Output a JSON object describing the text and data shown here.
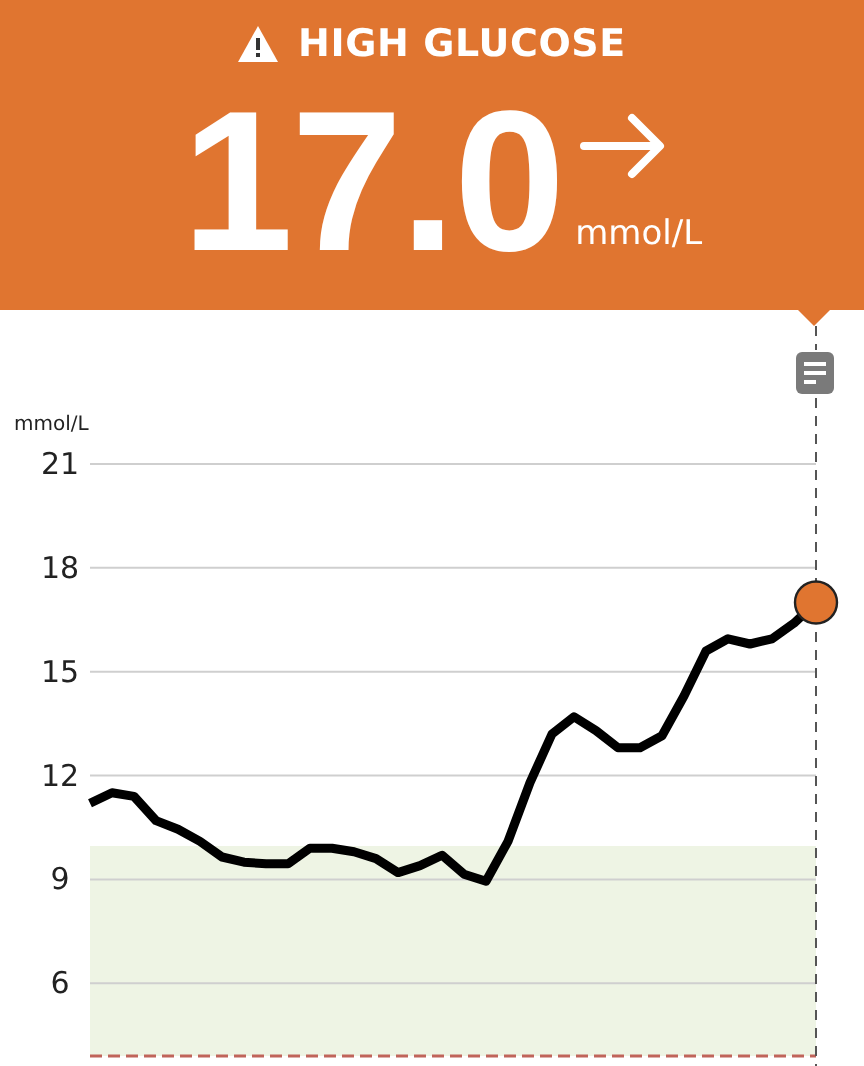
{
  "alert": {
    "kind": "high",
    "title": "HIGH GLUCOSE"
  },
  "reading": {
    "value": "17.0",
    "unit": "mmol/L"
  },
  "chart": {
    "chart_data": {
      "type": "line",
      "ylabel": "mmol/L",
      "grid": true,
      "ylim": [
        3.9,
        21
      ],
      "series": [
        {
          "color": "#000000",
          "values": [
            11.2,
            11.5,
            11.4,
            10.7,
            10.45,
            10.1,
            9.65,
            9.5,
            9.45,
            9.45,
            9.9,
            9.9,
            9.8,
            9.6,
            9.2,
            9.4,
            9.7,
            9.15,
            8.95,
            10.1,
            11.8,
            13.2,
            13.7,
            13.3,
            12.8,
            12.8,
            13.15,
            14.3,
            15.6,
            15.95,
            15.8,
            15.95,
            16.4,
            17.0
          ]
        }
      ],
      "yticks": [
        6,
        9,
        12,
        15,
        18,
        21
      ]
    }
  }
}
